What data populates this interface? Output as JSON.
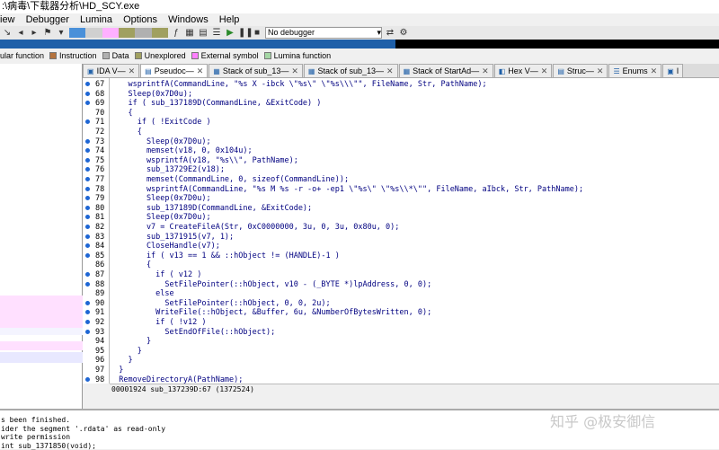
{
  "window": {
    "title": ":\\病毒\\下载器分析\\HD_SCY.exe"
  },
  "menu": [
    "iew",
    "Debugger",
    "Lumina",
    "Options",
    "Windows",
    "Help"
  ],
  "toolbar": {
    "debugger": "No debugger"
  },
  "legend": [
    {
      "label": "ular function",
      "color": ""
    },
    {
      "label": "Instruction",
      "color": "#b5733e"
    },
    {
      "label": "Data",
      "color": "#b0b0b0"
    },
    {
      "label": "Unexplored",
      "color": "#a0a060"
    },
    {
      "label": "External symbol",
      "color": "#ff80ff"
    },
    {
      "label": "Lumina function",
      "color": "#a5d7a5"
    }
  ],
  "tabs": [
    "IDA V—",
    "Pseudoc—",
    "Stack of sub_13—",
    "Stack of sub_13—",
    "Stack of StartAd—",
    "Hex V—",
    "Struc—",
    "Enums",
    "I"
  ],
  "code_lines": [
    {
      "n": "67",
      "dot": true,
      "text": "    wsprintfA(CommandLine, \"%s X -ibck \\\"%s\\\" \\\"%s\\\\\\\"\", FileName, Str, PathName);"
    },
    {
      "n": "68",
      "dot": true,
      "text": "    Sleep(0x7D0u);"
    },
    {
      "n": "69",
      "dot": true,
      "text": "    if ( sub_137189D(CommandLine, &ExitCode) )"
    },
    {
      "n": "70",
      "dot": false,
      "text": "    {"
    },
    {
      "n": "71",
      "dot": true,
      "text": "      if ( !ExitCode )"
    },
    {
      "n": "72",
      "dot": false,
      "text": "      {"
    },
    {
      "n": "73",
      "dot": true,
      "text": "        Sleep(0x7D0u);"
    },
    {
      "n": "74",
      "dot": true,
      "text": "        memset(v18, 0, 0x104u);"
    },
    {
      "n": "75",
      "dot": true,
      "text": "        wsprintfA(v18, \"%s\\\\\", PathName);"
    },
    {
      "n": "76",
      "dot": true,
      "text": "        sub_13729E2(v18);"
    },
    {
      "n": "77",
      "dot": true,
      "text": "        memset(CommandLine, 0, sizeof(CommandLine));"
    },
    {
      "n": "78",
      "dot": true,
      "text": "        wsprintfA(CommandLine, \"%s M %s -r -o+ -ep1 \\\"%s\\\" \\\"%s\\\\*\\\"\", FileName, aIbck, Str, PathName);"
    },
    {
      "n": "79",
      "dot": true,
      "text": "        Sleep(0x7D0u);"
    },
    {
      "n": "80",
      "dot": true,
      "text": "        sub_137189D(CommandLine, &ExitCode);"
    },
    {
      "n": "81",
      "dot": true,
      "text": "        Sleep(0x7D0u);"
    },
    {
      "n": "82",
      "dot": true,
      "text": "        v7 = CreateFileA(Str, 0xC0000000, 3u, 0, 3u, 0x80u, 0);"
    },
    {
      "n": "83",
      "dot": true,
      "text": "        sub_1371915(v7, 1);"
    },
    {
      "n": "84",
      "dot": true,
      "text": "        CloseHandle(v7);"
    },
    {
      "n": "85",
      "dot": true,
      "text": "        if ( v13 == 1 && ::hObject != (HANDLE)-1 )"
    },
    {
      "n": "86",
      "dot": false,
      "text": "        {"
    },
    {
      "n": "87",
      "dot": true,
      "text": "          if ( v12 )"
    },
    {
      "n": "88",
      "dot": true,
      "text": "            SetFilePointer(::hObject, v10 - (_BYTE *)lpAddress, 0, 0);"
    },
    {
      "n": "89",
      "dot": false,
      "text": "          else"
    },
    {
      "n": "90",
      "dot": true,
      "text": "            SetFilePointer(::hObject, 0, 0, 2u);"
    },
    {
      "n": "91",
      "dot": true,
      "text": "          WriteFile(::hObject, &Buffer, 6u, &NumberOfBytesWritten, 0);"
    },
    {
      "n": "92",
      "dot": true,
      "text": "          if ( !v12 )"
    },
    {
      "n": "93",
      "dot": true,
      "text": "            SetEndOfFile(::hObject);"
    },
    {
      "n": "94",
      "dot": false,
      "text": "        }"
    },
    {
      "n": "95",
      "dot": false,
      "text": "      }"
    },
    {
      "n": "96",
      "dot": false,
      "text": "    }"
    },
    {
      "n": "97",
      "dot": false,
      "text": "  }"
    },
    {
      "n": "98",
      "dot": true,
      "text": "  RemoveDirectoryA(PathName);"
    }
  ],
  "status": "00001924 sub_137239D:67 (1372524)",
  "output": [
    "s been finished.",
    "ider the segment '.rdata' as read-only",
    " write permission",
    " int sub_1371850(void);"
  ],
  "watermark": "知乎 @极安御信"
}
